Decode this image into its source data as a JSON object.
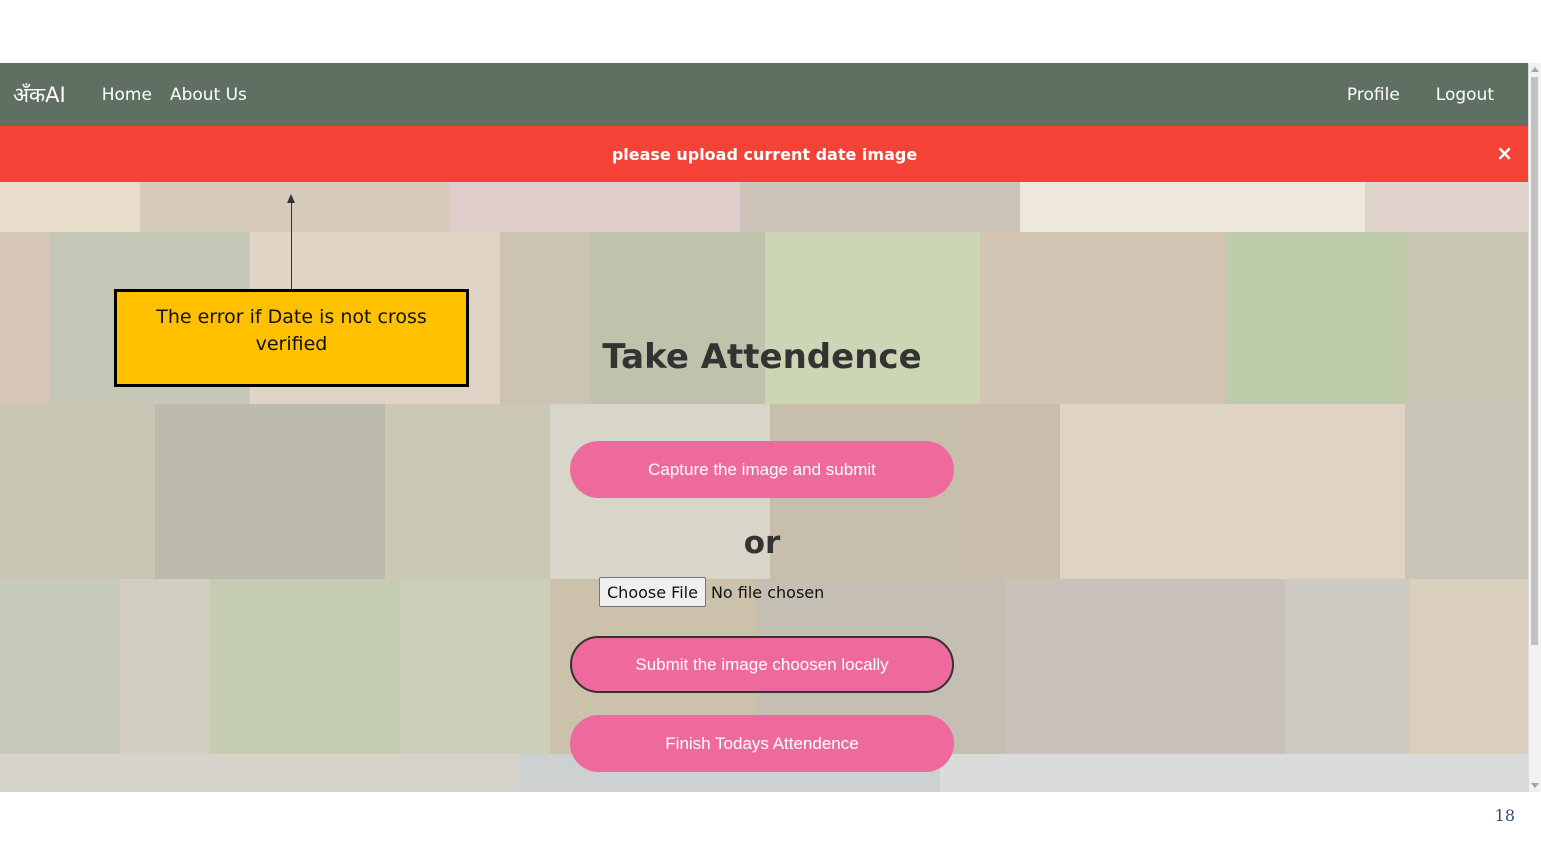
{
  "navbar": {
    "brand": "अँकAI",
    "links_left": [
      "Home",
      "About Us"
    ],
    "links_right": [
      "Profile",
      "Logout"
    ]
  },
  "alert": {
    "message": "please upload current date image",
    "close_symbol": "×"
  },
  "main": {
    "title": "Take Attendence",
    "capture_button": "Capture the image and submit",
    "or_text": "or",
    "file_input": {
      "button_label": "Choose File",
      "status": "No file chosen"
    },
    "submit_button": "Submit the image choosen locally",
    "finish_button": "Finish Todays Attendence"
  },
  "annotation": {
    "callout_text": "The error if Date is not cross verified"
  },
  "page_number": "18",
  "colors": {
    "navbar": "#5f6f62",
    "alert": "#f44336",
    "button": "#ee6a9c",
    "callout": "#ffc000"
  }
}
